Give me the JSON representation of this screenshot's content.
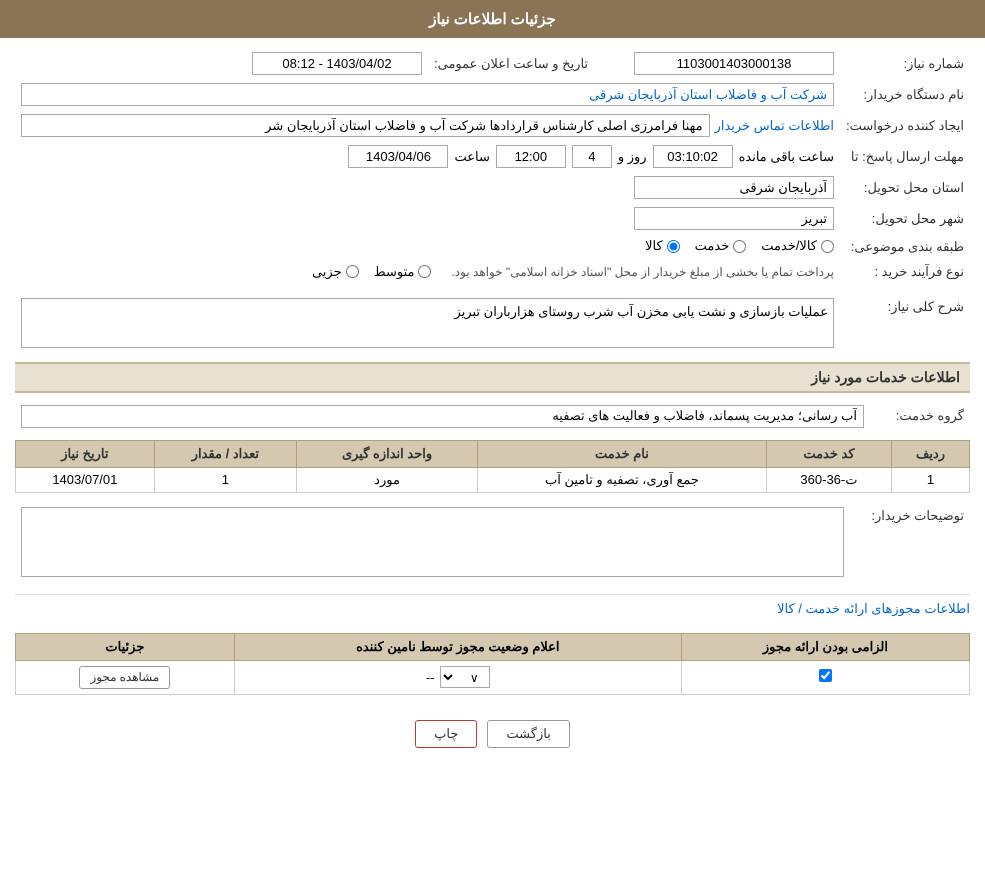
{
  "header": {
    "title": "جزئیات اطلاعات نیاز"
  },
  "form": {
    "need_number_label": "شماره نیاز:",
    "need_number_value": "1103001403000138",
    "announcement_date_label": "تاریخ و ساعت اعلان عمومی:",
    "announcement_date_value": "1403/04/02 - 08:12",
    "buyer_org_label": "نام دستگاه خریدار:",
    "buyer_org_value": "شرکت آب و فاضلاب استان آذربایجان شرقی",
    "requester_label": "ایجاد کننده درخواست:",
    "requester_value": "مهنا فرامرزی اصلی کارشناس قراردادها شرکت آب و فاضلاب استان آذربایجان شر",
    "requester_link": "اطلاعات تماس خریدار",
    "response_deadline_label": "مهلت ارسال پاسخ: تا",
    "response_date": "1403/04/06",
    "response_time": "12:00",
    "response_days": "4",
    "response_remaining": "03:10:02",
    "response_time_label": "ساعت",
    "response_days_label": "روز و",
    "response_remaining_label": "ساعت باقی مانده",
    "delivery_province_label": "استان محل تحویل:",
    "delivery_province_value": "آذربایجان شرقی",
    "delivery_city_label": "شهر محل تحویل:",
    "delivery_city_value": "تبریز",
    "category_label": "طبقه بندی موضوعی:",
    "category_options": [
      "کالا",
      "خدمت",
      "کالا/خدمت"
    ],
    "category_selected": "کالا",
    "purchase_type_label": "نوع فرآیند خرید :",
    "purchase_options": [
      "جزیی",
      "متوسط"
    ],
    "purchase_note": "پرداخت تمام یا بخشی از مبلغ خریدار از محل \"اسناد خزانه اسلامی\" خواهد بود.",
    "description_label": "شرح کلی نیاز:",
    "description_value": "عملیات بازسازی و نشت یابی مخزن آب شرب روستای هزارباران تبریز",
    "services_section_title": "اطلاعات خدمات مورد نیاز",
    "service_group_label": "گروه خدمت:",
    "service_group_value": "آب رسانی؛ مدیریت پسماند، فاضلاب و فعالیت های تصفیه",
    "table": {
      "headers": [
        "ردیف",
        "کد خدمت",
        "نام خدمت",
        "واحد اندازه گیری",
        "تعداد / مقدار",
        "تاریخ نیاز"
      ],
      "rows": [
        {
          "row": "1",
          "code": "ت-36-360",
          "name": "جمع آوری، تصفیه و تامین آب",
          "unit": "مورد",
          "quantity": "1",
          "date": "1403/07/01"
        }
      ]
    },
    "buyer_notes_label": "توضیحات خریدار:",
    "buyer_notes_value": "",
    "permissions_title": "اطلاعات مجوزهای ارائه خدمت / کالا",
    "permissions_table": {
      "headers": [
        "الزامی بودن ارائه مجوز",
        "اعلام وضعیت مجوز توسط نامین کننده",
        "جزئیات"
      ],
      "rows": [
        {
          "required": true,
          "status": "--",
          "details_label": "مشاهده مجوز"
        }
      ]
    }
  },
  "buttons": {
    "print_label": "چاپ",
    "back_label": "بازگشت"
  }
}
